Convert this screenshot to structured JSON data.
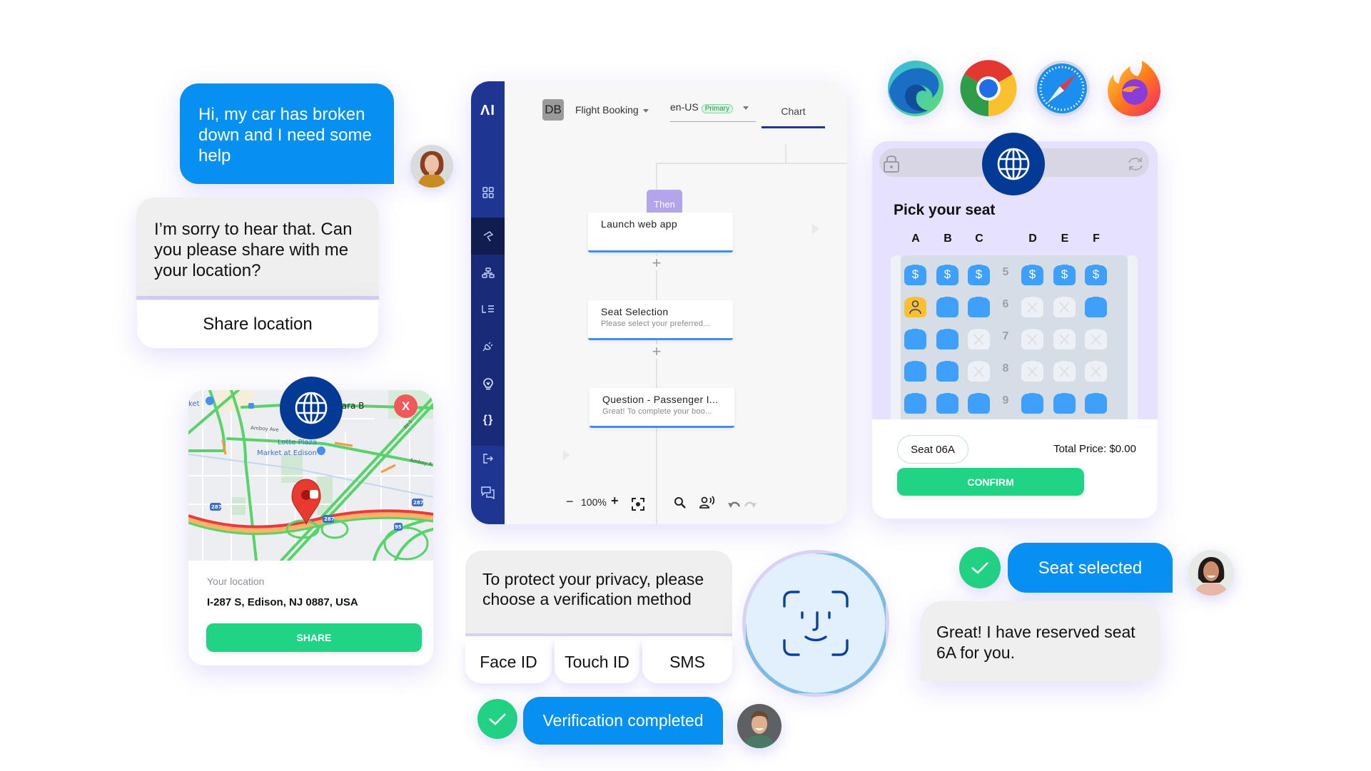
{
  "chat_left": {
    "user_message": "Hi, my car has broken down and I need some help",
    "bot_message": "I’m sorry to hear that. Can you please share with me your location?",
    "share_location_label": "Share location"
  },
  "map_card": {
    "map_labels": {
      "place1": "Clara B",
      "road1": "Amboy Ave",
      "road2": "Amboy A",
      "poi": "Lotte Plaza\nMarket at Edison",
      "poi_line1": "Lotte Plaza",
      "poi_line2": "Market at Edison",
      "poi_left": "ket",
      "route_rt1": "Rt-1",
      "shield_287": "287",
      "shield_95": "95"
    },
    "close_label": "X",
    "location_label": "Your location",
    "address": "I-287 S, Edison, NJ 0887, USA",
    "share_button": "SHARE"
  },
  "flow_builder": {
    "logo": "ΛI",
    "avatar_initials": "DB",
    "project_name": "Flight Booking",
    "locale": "en-US",
    "locale_tag": "Primary",
    "active_tab": "Chart",
    "sidebar_icons": [
      "grid-icon",
      "pin-tool-icon",
      "hierarchy-icon",
      "list-icon",
      "plug-icon",
      "lightbulb-icon",
      "code-braces-icon",
      "exit-icon",
      "chat-icon"
    ],
    "selected_sidebar_index": 1,
    "then_label": "Then",
    "nodes": [
      {
        "title": "Launch web app",
        "subtitle": ""
      },
      {
        "title": "Seat Selection",
        "subtitle": "Please select your preferred..."
      },
      {
        "title": "Question - Passenger I...",
        "subtitle": "Great! To complete your boo..."
      }
    ],
    "zoom_level": "100%",
    "zoom_out": "−",
    "zoom_in": "+"
  },
  "browsers": [
    "edge-icon",
    "chrome-icon",
    "safari-icon",
    "firefox-icon"
  ],
  "seat_card": {
    "title": "Pick your seat",
    "columns_left": [
      "A",
      "B",
      "C"
    ],
    "columns_right": [
      "D",
      "E",
      "F"
    ],
    "rows": [
      {
        "num": "5",
        "seats": [
          "premium",
          "premium",
          "premium",
          "premium",
          "premium",
          "premium"
        ]
      },
      {
        "num": "6",
        "seats": [
          "selected",
          "available",
          "available",
          "taken",
          "taken",
          "available"
        ]
      },
      {
        "num": "7",
        "seats": [
          "available",
          "available",
          "taken",
          "taken",
          "taken",
          "taken"
        ]
      },
      {
        "num": "8",
        "seats": [
          "available",
          "available",
          "taken",
          "taken",
          "taken",
          "taken"
        ]
      },
      {
        "num": "9",
        "seats": [
          "available",
          "available",
          "available",
          "available",
          "available",
          "available"
        ]
      },
      {
        "num": "",
        "seats": [
          "available",
          "available",
          "available",
          "taken",
          "taken",
          "available"
        ]
      }
    ],
    "premium_symbol": "$",
    "selected_seat": "Seat 06A",
    "total_price": "Total Price: $0.00",
    "confirm_button": "CONFIRM"
  },
  "privacy": {
    "question": "To protect your privacy, please choose a verification method",
    "options": [
      "Face ID",
      "Touch ID",
      "SMS"
    ],
    "verification_message": "Verification completed"
  },
  "seat_chat": {
    "user_message": "Seat selected",
    "bot_message": "Great! I have reserved seat 6A for you."
  },
  "colors": {
    "user_bubble": "#0690f2",
    "bot_bubble": "#efefef",
    "green": "#21d385",
    "navy": "#033a95",
    "sidebar": "#1f3592",
    "seat_available": "#3fa0fb",
    "seat_selected": "#fcc02e"
  }
}
